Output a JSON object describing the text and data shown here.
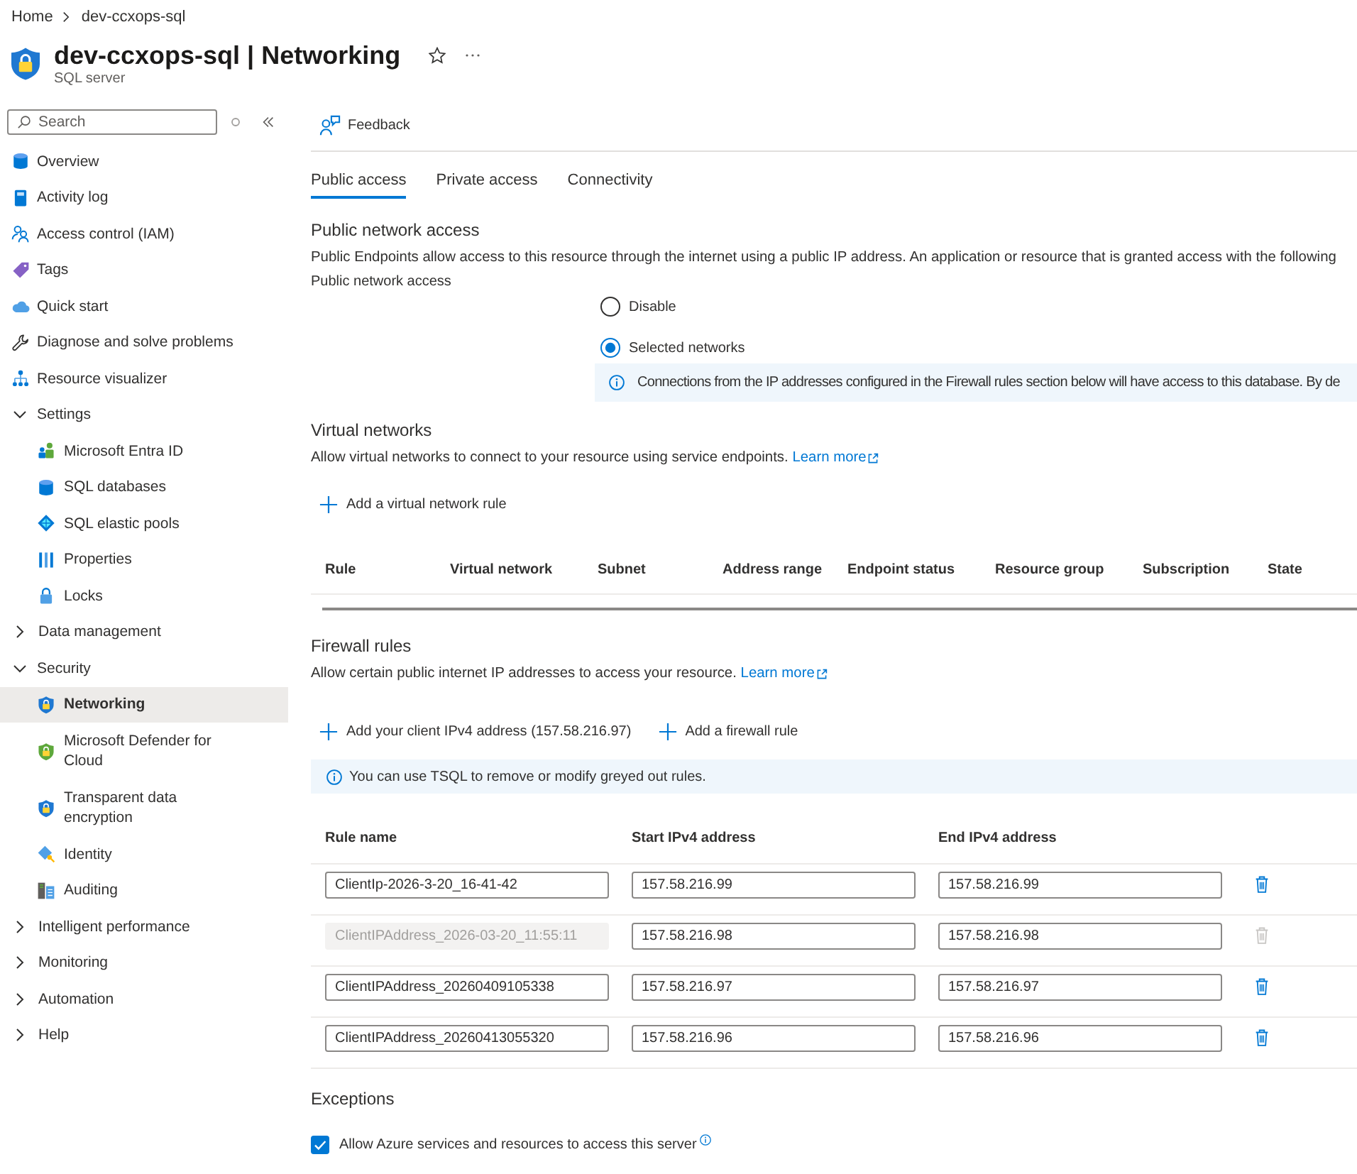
{
  "breadcrumb": [
    {
      "label": "Home"
    },
    {
      "label": "dev-ccxops-sql"
    }
  ],
  "header": {
    "title": "dev-ccxops-sql | Networking",
    "subtitle": "SQL server"
  },
  "sidebar": {
    "search": {
      "placeholder": "Search"
    },
    "items": [
      {
        "kind": "link",
        "label": "Overview",
        "selected": false
      },
      {
        "kind": "link",
        "label": "Activity log",
        "selected": false
      },
      {
        "kind": "link",
        "label": "Access control (IAM)",
        "selected": false
      },
      {
        "kind": "link",
        "label": "Tags",
        "selected": false
      },
      {
        "kind": "link",
        "label": "Quick start",
        "selected": false
      },
      {
        "kind": "link",
        "label": "Diagnose and solve problems",
        "selected": false
      },
      {
        "kind": "link",
        "label": "Resource visualizer",
        "selected": false
      },
      {
        "kind": "group",
        "label": "Settings",
        "selected": false,
        "expanded": true,
        "children": [
          {
            "kind": "link",
            "label": "Microsoft Entra ID",
            "selected": false
          },
          {
            "kind": "link",
            "label": "SQL databases",
            "selected": false
          },
          {
            "kind": "link",
            "label": "SQL elastic pools",
            "selected": false
          },
          {
            "kind": "link",
            "label": "Properties",
            "selected": false
          },
          {
            "kind": "link",
            "label": "Locks",
            "selected": false
          }
        ]
      },
      {
        "kind": "group",
        "label": "Data management",
        "selected": false,
        "expanded": false
      },
      {
        "kind": "group",
        "label": "Security",
        "selected": false,
        "expanded": true,
        "children": [
          {
            "kind": "link",
            "label": "Networking",
            "selected": true
          },
          {
            "kind": "link",
            "label": "Microsoft Defender for Cloud",
            "selected": false
          },
          {
            "kind": "link",
            "label": "Transparent data encryption",
            "selected": false
          },
          {
            "kind": "link",
            "label": "Identity",
            "selected": false
          },
          {
            "kind": "link",
            "label": "Auditing",
            "selected": false
          }
        ]
      },
      {
        "kind": "group",
        "label": "Intelligent performance",
        "selected": false,
        "expanded": false
      },
      {
        "kind": "group",
        "label": "Monitoring",
        "selected": false,
        "expanded": false
      },
      {
        "kind": "group",
        "label": "Automation",
        "selected": false,
        "expanded": false
      },
      {
        "kind": "group",
        "label": "Help",
        "selected": false,
        "expanded": false
      }
    ]
  },
  "toolbar": {
    "feedback": "Feedback"
  },
  "tabs": [
    {
      "label": "Public access",
      "selected": true
    },
    {
      "label": "Private access",
      "selected": false
    },
    {
      "label": "Connectivity",
      "selected": false
    }
  ],
  "public_network_access": {
    "heading": "Public network access",
    "description": "Public Endpoints allow access to this resource through the internet using a public IP address. An application or resource that is granted access with the following",
    "field_label": "Public network access",
    "options": [
      {
        "label": "Disable",
        "selected": false
      },
      {
        "label": "Selected networks",
        "selected": true
      }
    ],
    "info": "Connections from the IP addresses configured in the Firewall rules section below will have access to this database. By de"
  },
  "virtual_networks": {
    "heading": "Virtual networks",
    "description": "Allow virtual networks to connect to your resource using service endpoints.",
    "link": "Learn more",
    "add_button": "Add a virtual network rule",
    "columns": [
      "Rule",
      "Virtual network",
      "Subnet",
      "Address range",
      "Endpoint status",
      "Resource group",
      "Subscription",
      "State"
    ]
  },
  "firewall_rules": {
    "heading": "Firewall rules",
    "description": "Allow certain public internet IP addresses to access your resource.",
    "link": "Learn more",
    "actions": [
      "Add your client IPv4 address (157.58.216.97)",
      "Add a firewall rule"
    ],
    "info": "You can use TSQL to remove or modify greyed out rules.",
    "columns": [
      "Rule name",
      "Start IPv4 address",
      "End IPv4 address"
    ],
    "rows": [
      {
        "name": "ClientIp-2026-3-20_16-41-42",
        "start": "157.58.216.99",
        "end": "157.58.216.99",
        "disabled": false
      },
      {
        "name": "ClientIPAddress_2026-03-20_11:55:11",
        "start": "157.58.216.98",
        "end": "157.58.216.98",
        "disabled": true
      },
      {
        "name": "ClientIPAddress_20260409105338",
        "start": "157.58.216.97",
        "end": "157.58.216.97",
        "disabled": false
      },
      {
        "name": "ClientIPAddress_20260413055320",
        "start": "157.58.216.96",
        "end": "157.58.216.96",
        "disabled": false
      }
    ]
  },
  "exceptions": {
    "heading": "Exceptions",
    "options": [
      {
        "label": "Allow Azure services and resources to access this server",
        "checked": true
      }
    ]
  }
}
